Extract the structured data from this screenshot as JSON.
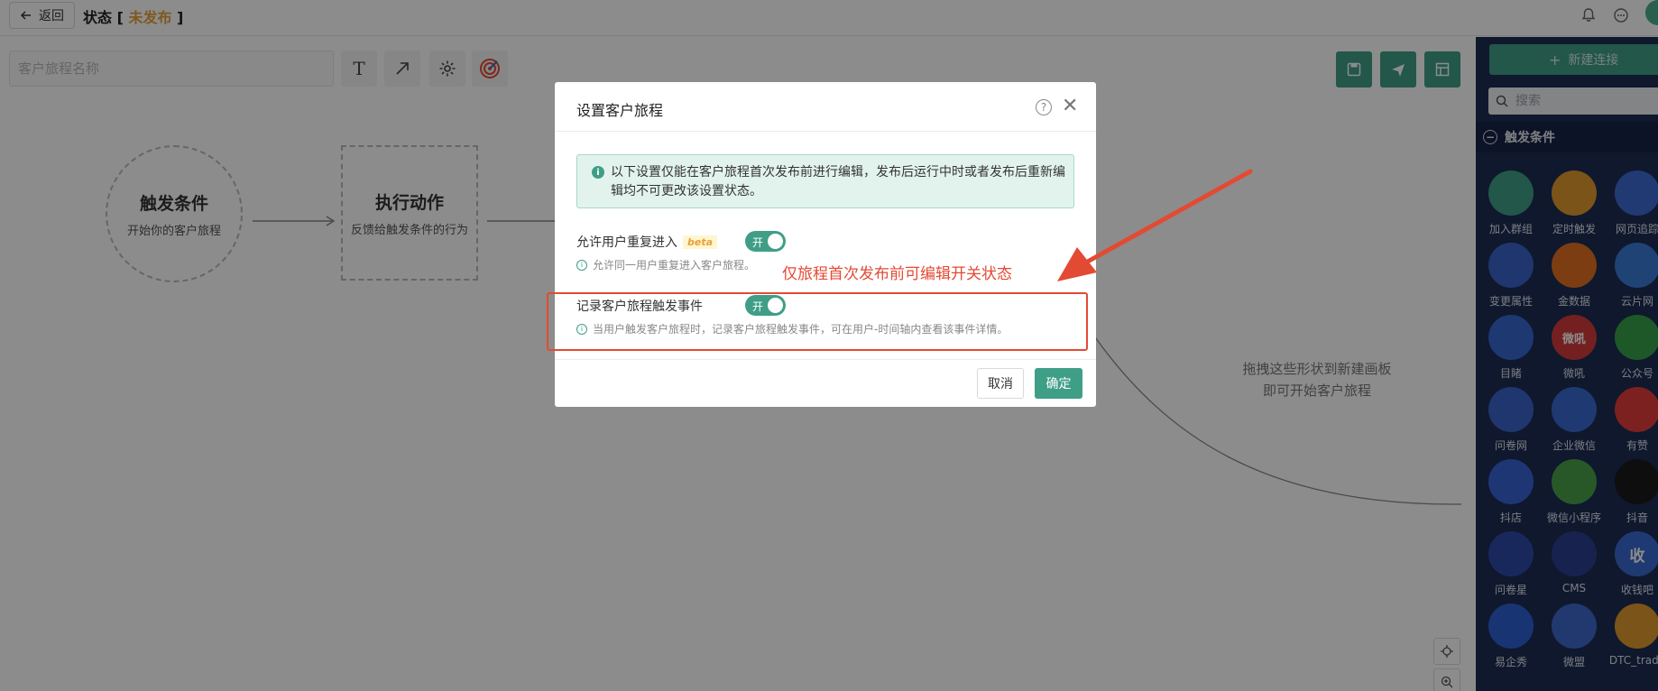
{
  "topbar": {
    "back_label": "返回",
    "title_prefix": "状态 [ ",
    "status": "未发布",
    "title_suffix": " ]"
  },
  "toolbar": {
    "name_placeholder": "客户旅程名称",
    "text_tool_glyph": "T"
  },
  "canvas": {
    "trigger_node": {
      "title": "触发条件",
      "subtitle": "开始你的客户旅程"
    },
    "action_node": {
      "title": "执行动作",
      "subtitle": "反馈给触发条件的行为"
    },
    "hint_line1": "拖拽这些形状到新建画板",
    "hint_line2": "即可开始客户旅程"
  },
  "right_panel": {
    "new_connection_label": "新建连接",
    "search_placeholder": "搜索",
    "section_title": "触发条件",
    "integrations": [
      {
        "label": "加入群组",
        "icon": "user-add-icon",
        "color": "#3f9e86",
        "glyph": ""
      },
      {
        "label": "定时触发",
        "icon": "clock-icon",
        "color": "#e09a2e",
        "glyph": ""
      },
      {
        "label": "网页追踪",
        "icon": "webpage-icon",
        "color": "#3d6bd1",
        "glyph": ""
      },
      {
        "label": "变更属性",
        "icon": "edit-icon",
        "color": "#3a63c9",
        "glyph": ""
      },
      {
        "label": "金数据",
        "icon": "jinshuju-icon",
        "color": "#e06f1f",
        "glyph": ""
      },
      {
        "label": "云片网",
        "icon": "cloud-icon",
        "color": "#3b7bd6",
        "glyph": ""
      },
      {
        "label": "目睹",
        "icon": "play-icon",
        "color": "#3867d0",
        "glyph": ""
      },
      {
        "label": "微吼",
        "icon": "weihou-icon",
        "color": "#d33b3b",
        "glyph": "微吼"
      },
      {
        "label": "公众号",
        "icon": "wechat-icon",
        "color": "#3aa14a",
        "glyph": ""
      },
      {
        "label": "问卷网",
        "icon": "wenjuan-icon",
        "color": "#3a63c9",
        "glyph": ""
      },
      {
        "label": "企业微信",
        "icon": "wecom-icon",
        "color": "#3a6ad0",
        "glyph": ""
      },
      {
        "label": "有赞",
        "icon": "youzan-icon",
        "color": "#e33b3b",
        "glyph": ""
      },
      {
        "label": "抖店",
        "icon": "doudian-icon",
        "color": "#3a63d6",
        "glyph": ""
      },
      {
        "label": "微信小程序",
        "icon": "miniprogram-icon",
        "color": "#4aa04a",
        "glyph": ""
      },
      {
        "label": "抖音",
        "icon": "douyin-icon",
        "color": "#1b1b1b",
        "glyph": ""
      },
      {
        "label": "问卷星",
        "icon": "star-icon",
        "color": "#2f4aa8",
        "glyph": ""
      },
      {
        "label": "CMS",
        "icon": "cms-icon",
        "color": "#2a3f8f",
        "glyph": ""
      },
      {
        "label": "收钱吧",
        "icon": "shouqianba-icon",
        "color": "#3a6ad0",
        "glyph": "收"
      },
      {
        "label": "易企秀",
        "icon": "yiqixiu-icon",
        "color": "#2f5fd0",
        "glyph": ""
      },
      {
        "label": "微盟",
        "icon": "weimeng-icon",
        "color": "#3c68c9",
        "glyph": ""
      },
      {
        "label": "DTC_trade",
        "icon": "wrench-icon",
        "color": "#e09a2e",
        "glyph": ""
      }
    ]
  },
  "modal": {
    "title": "设置客户旅程",
    "help_glyph": "?",
    "close_glyph": "✕",
    "alert_text": "以下设置仅能在客户旅程首次发布前进行编辑，发布后运行中时或者发布后重新编辑均不可更改该设置状态。",
    "option1": {
      "label": "允许用户重复进入",
      "badge": "beta",
      "switch_text": "开",
      "desc": "允许同一用户重复进入客户旅程。"
    },
    "option2": {
      "label": "记录客户旅程触发事件",
      "switch_text": "开",
      "desc": "当用户触发客户旅程时，记录客户旅程触发事件，可在用户-时间轴内查看该事件详情。"
    },
    "cancel_label": "取消",
    "ok_label": "确定"
  },
  "annotation": {
    "text": "仅旅程首次发布前可编辑开关状态",
    "color": "#e34a33"
  },
  "colors": {
    "accent": "#3f9e86",
    "panel_bg": "#1d2d52",
    "status": "#e6a23c"
  }
}
